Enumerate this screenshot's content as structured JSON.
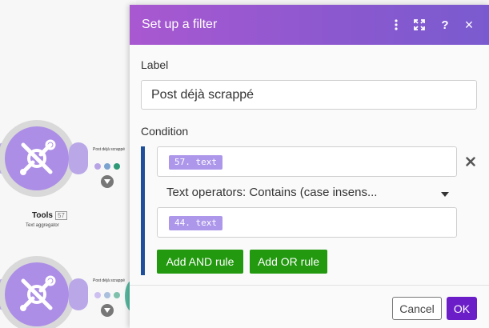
{
  "canvas": {
    "modules": [
      {
        "title": "Tools",
        "badge": "57",
        "subtitle": "Text aggregator",
        "route_label": "Post déjà scrappé"
      },
      {
        "title": "",
        "badge": "",
        "subtitle": "",
        "route_label": "Post déjà scrappé"
      }
    ],
    "colors": {
      "module_core": "#ac8ee6",
      "dot_light": "#b7a3e6",
      "dot_mid": "#7aa3cf",
      "dot_teal": "#2e9977"
    }
  },
  "dialog": {
    "title": "Set up a filter",
    "header_icons": [
      "more-vertical-icon",
      "expand-icon",
      "help-icon",
      "close-icon"
    ],
    "help_glyph": "?",
    "close_glyph": "×",
    "label_caption": "Label",
    "label_value": "Post déjà scrappé",
    "condition_caption": "Condition",
    "condition": {
      "first_operand": "57. text",
      "operator": "Text operators: Contains (case insens...",
      "second_operand": "44. text"
    },
    "add_and_label": "Add AND rule",
    "add_or_label": "Add OR rule",
    "cancel_label": "Cancel",
    "ok_label": "OK",
    "colors": {
      "header_start": "#a958d0",
      "header_end": "#7a5bcf",
      "green": "#22990f",
      "ok": "#6b1ec8",
      "condition_bar": "#1f4e9a"
    }
  }
}
